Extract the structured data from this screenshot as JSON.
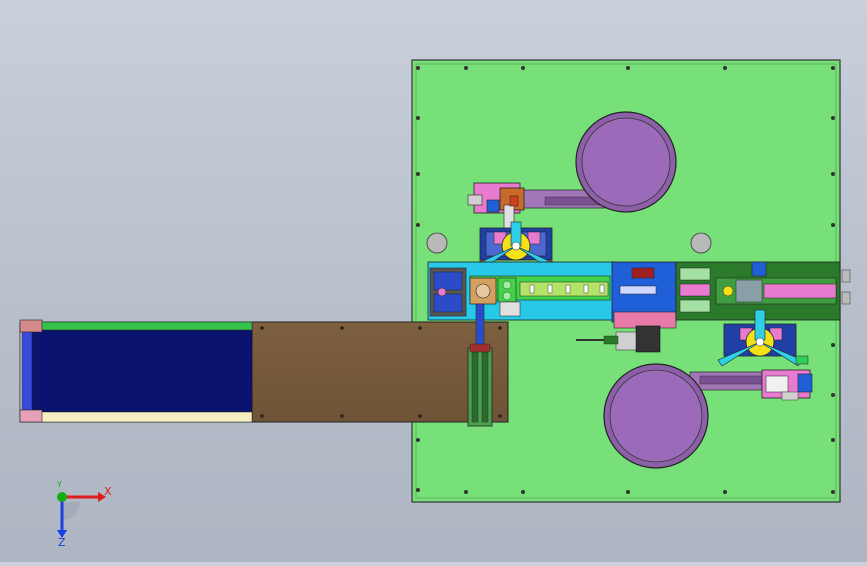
{
  "window": {
    "viewport_background_top": "#c9d0db",
    "viewport_background_bottom": "#aeb6c3"
  },
  "model": {
    "plate_color": "#78e078",
    "conveyor_belt_color": "#0a1470",
    "wood_plate_color": "#7a5c3c",
    "turntable_color": "#9b6ab8",
    "track_color": "#27c8e8",
    "block_blue": "#1f5fd8",
    "block_pink": "#e87ad0",
    "block_yellow": "#f5e11a",
    "block_dark_green": "#2b7a2b"
  },
  "triad": {
    "x_label": "X",
    "y_label": "Y",
    "z_label": "Z",
    "x_color": "#e11b1b",
    "y_color": "#11b011",
    "z_color": "#1a3fe0",
    "icon": "axis-triad-icon"
  }
}
